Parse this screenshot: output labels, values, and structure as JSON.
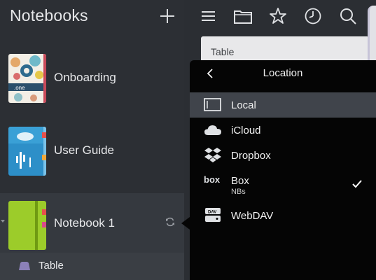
{
  "sidebar": {
    "title": "Notebooks",
    "notebooks": [
      {
        "label": "Onboarding",
        "cover_color": "#f3efe6",
        "cover_text": ".one"
      },
      {
        "label": "User Guide",
        "cover_color": "#2d8fc8"
      },
      {
        "label": "Notebook 1",
        "cover_color": "#9ccc2a"
      }
    ],
    "section": {
      "label": "Table"
    }
  },
  "page": {
    "title": "Table"
  },
  "location_popover": {
    "title": "Location",
    "items": [
      {
        "label": "Local",
        "icon": "local-storage-icon"
      },
      {
        "label": "iCloud",
        "icon": "icloud-icon"
      },
      {
        "label": "Dropbox",
        "icon": "dropbox-icon"
      },
      {
        "label": "Box",
        "sublabel": "NBs",
        "icon": "box-icon",
        "checked": true
      },
      {
        "label": "WebDAV",
        "icon": "webdav-icon"
      }
    ]
  },
  "colors": {
    "sidebar_bg": "#2c2f34",
    "popover_bg": "#050505",
    "active_row": "#40444b",
    "icon": "#dfe1e4"
  }
}
